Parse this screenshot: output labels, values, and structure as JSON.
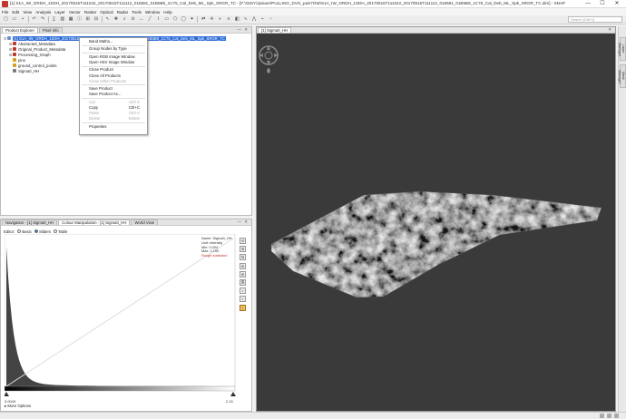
{
  "window": {
    "title": "[1] S1A_IW_GRDH_1SDH_20170515T111042_20170515T111112_016581_01B5B9_1C75_Cal_Deb_ML_Spk_SRGR_TC - [F:\\GIDY\\Jpsiaer\\PULLING_DVG_paS7OW\\S1A_IW_GRDH_1SDH_20170515T111042_20170515T111112_016581_01B5B9_1C75_Cal_Deb_ML_Spk_SRGR_TC.dim] - SNAP",
    "minimize": "—",
    "maximize": "☐",
    "close": "✕"
  },
  "menu": [
    "File",
    "Edit",
    "View",
    "Analysis",
    "Layer",
    "Vector",
    "Raster",
    "Optical",
    "Radar",
    "Tools",
    "Window",
    "Help"
  ],
  "toolbar": {
    "search_placeholder": "Search (Ctrl+I)"
  },
  "explorer": {
    "tabs": [
      "Product Explorer",
      "Pixel Info"
    ],
    "controls": "— ✕",
    "tree": [
      {
        "label": "[1] S1A_IW_GRDH_1SDH_20170515T111042_20170515T111112_016581_01B5B9_1C75_Cal_Deb_ML_Spk_SRGR_TC",
        "selected": true,
        "expander": "⊟",
        "color": "#6a8fd0"
      },
      {
        "label": "Abstracted_Metadata",
        "selected": false,
        "expander": "⊞",
        "color": "#c0392b"
      },
      {
        "label": "Original_Product_Metadata",
        "selected": false,
        "expander": "⊞",
        "color": "#c0392b"
      },
      {
        "label": "Processing_Graph",
        "selected": false,
        "expander": "⊞",
        "color": "#c0392b"
      },
      {
        "label": "pins",
        "selected": false,
        "expander": "",
        "color": "#d5a020"
      },
      {
        "label": "ground_control_points",
        "selected": false,
        "expander": "",
        "color": "#d5a020"
      },
      {
        "label": "Sigma0_HH",
        "selected": false,
        "expander": "",
        "color": "#7a7a7a"
      }
    ]
  },
  "context_menu": [
    {
      "label": "Band Maths...",
      "shortcut": "",
      "disabled": false
    },
    {
      "sep": true
    },
    {
      "label": "Group Nodes by Type",
      "shortcut": "",
      "disabled": false
    },
    {
      "sep": true
    },
    {
      "label": "Open RGB Image Window",
      "shortcut": "",
      "disabled": false
    },
    {
      "label": "Open HSV Image Window",
      "shortcut": "",
      "disabled": false
    },
    {
      "sep": true
    },
    {
      "label": "Close Product",
      "shortcut": "",
      "disabled": false
    },
    {
      "label": "Close All Products",
      "shortcut": "",
      "disabled": false
    },
    {
      "label": "Close Other Products",
      "shortcut": "",
      "disabled": true
    },
    {
      "sep": true
    },
    {
      "label": "Save Product",
      "shortcut": "",
      "disabled": false
    },
    {
      "label": "Save Product As...",
      "shortcut": "",
      "disabled": false
    },
    {
      "sep": true
    },
    {
      "label": "Cut",
      "shortcut": "Ctrl+X",
      "disabled": true
    },
    {
      "label": "Copy",
      "shortcut": "Ctrl+C",
      "disabled": false
    },
    {
      "label": "Paste",
      "shortcut": "Ctrl+V",
      "disabled": true
    },
    {
      "label": "Delete",
      "shortcut": "Delete",
      "disabled": true
    },
    {
      "sep": true
    },
    {
      "label": "Properties",
      "shortcut": "",
      "disabled": false
    }
  ],
  "colour_panel": {
    "tabs": [
      "Navigation - [1] Sigma0_HH",
      "Colour Manipulation - [1] Sigma0_HH",
      "World View"
    ],
    "controls": "— ✕",
    "editor_label": "Editor:",
    "radio_options": [
      {
        "label": "Basic",
        "on": false
      },
      {
        "label": "Sliders",
        "on": true
      },
      {
        "label": "Table",
        "on": false
      }
    ],
    "info": {
      "name": "Name: Sigma0_HH",
      "unit": "Unit: intensity",
      "min": "Min: 0.004",
      "max": "Max: 2.150",
      "warning": "Rough statistics!"
    },
    "slider_min_label": "0.0049",
    "slider_max_label": "2.15",
    "more_options": "More Options",
    "side_icons": [
      "⟲",
      "⇅",
      "⇅",
      "⊕",
      "⊕",
      "≣",
      "↕",
      "↕",
      "!"
    ]
  },
  "image_window": {
    "tab": "[1] Sigma0_HH",
    "controls": "✕"
  },
  "right_strip": [
    "Layer Manager",
    "Mask Manager"
  ]
}
